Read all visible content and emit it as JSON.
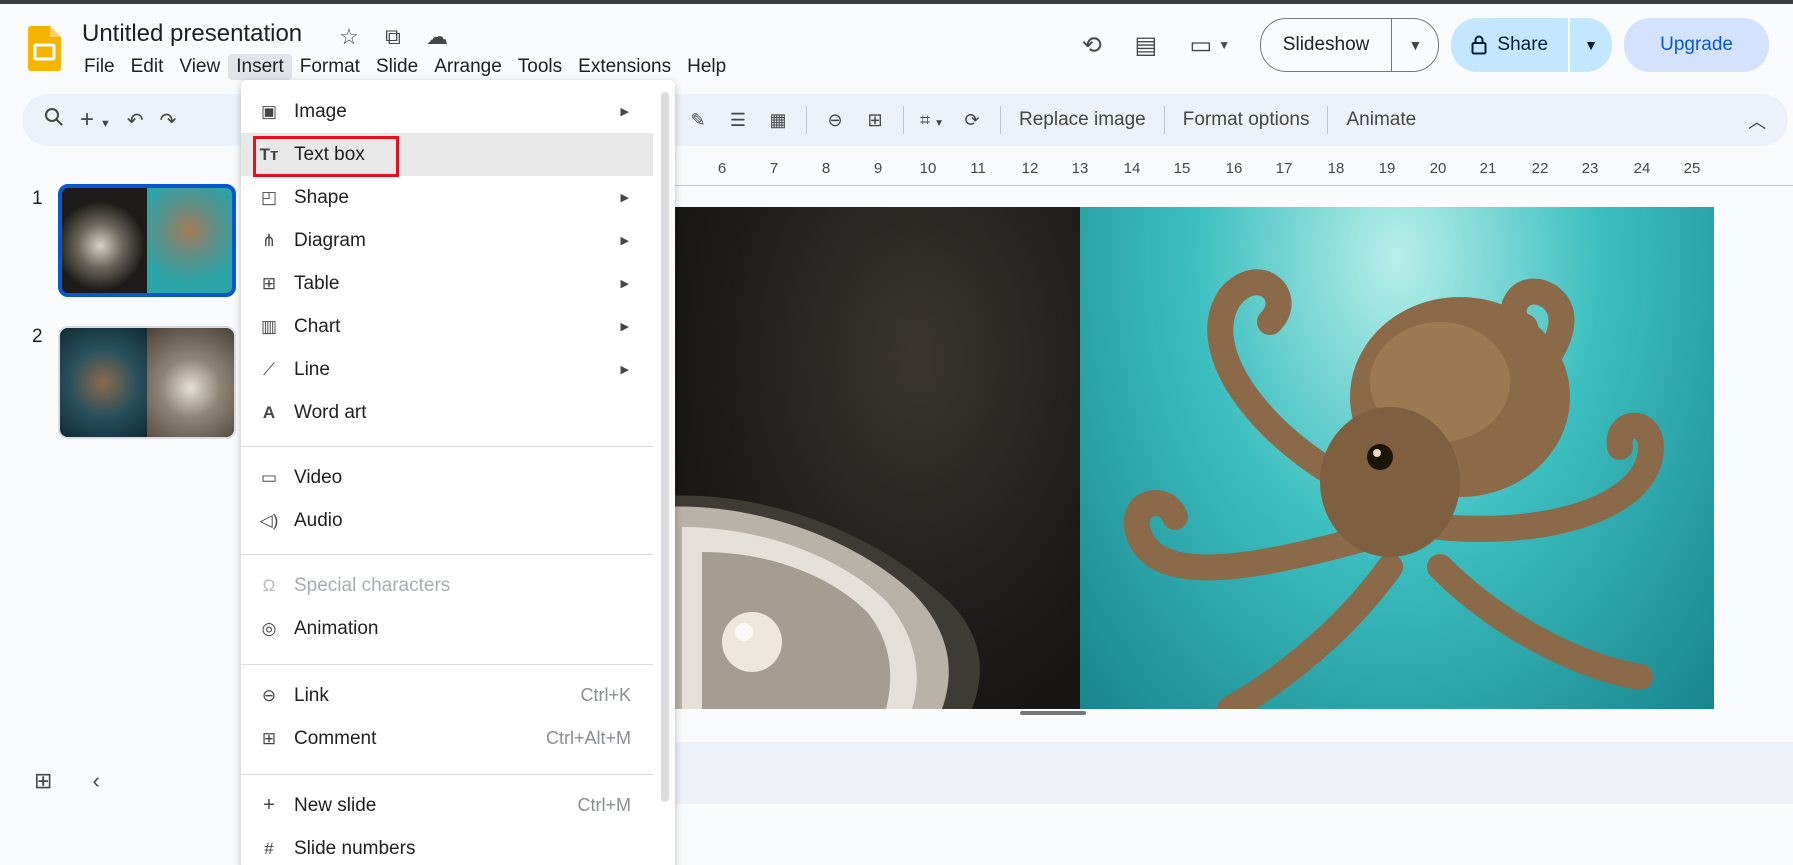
{
  "app": {
    "title": "Untitled presentation",
    "title_icons": [
      "star-icon",
      "move-to-folder-icon",
      "cloud-status-icon"
    ],
    "menu": [
      "File",
      "Edit",
      "View",
      "Insert",
      "Format",
      "Slide",
      "Arrange",
      "Tools",
      "Extensions",
      "Help"
    ],
    "active_menu": "Insert"
  },
  "header_actions": {
    "icons": [
      "history-icon",
      "comment-icon",
      "video-call-icon"
    ],
    "slideshow_label": "Slideshow",
    "share_label": "Share",
    "upgrade_label": "Upgrade"
  },
  "toolbar": {
    "left_icons": [
      "search-icon",
      "add-icon",
      "undo-icon",
      "redo-icon"
    ],
    "right_icons": [
      "pen-icon",
      "border-weight-icon",
      "border-dash-icon",
      "link-icon",
      "add-comment-icon",
      "crop-icon",
      "reset-image-icon"
    ],
    "replace_image": "Replace image",
    "format_options": "Format options",
    "animate": "Animate"
  },
  "slides": [
    {
      "number": "1",
      "selected": true
    },
    {
      "number": "2",
      "selected": false
    }
  ],
  "ruler": [
    "6",
    "7",
    "8",
    "9",
    "10",
    "11",
    "12",
    "13",
    "14",
    "15",
    "16",
    "17",
    "18",
    "19",
    "20",
    "21",
    "22",
    "23",
    "24",
    "25"
  ],
  "insert_menu": {
    "items": [
      {
        "label": "Image",
        "icon": "image-icon",
        "submenu": true
      },
      {
        "label": "Text box",
        "icon": "text-box-icon",
        "highlighted": true
      },
      {
        "label": "Shape",
        "icon": "shape-icon",
        "submenu": true
      },
      {
        "label": "Diagram",
        "icon": "diagram-icon",
        "submenu": true
      },
      {
        "label": "Table",
        "icon": "table-icon",
        "submenu": true
      },
      {
        "label": "Chart",
        "icon": "chart-icon",
        "submenu": true
      },
      {
        "label": "Line",
        "icon": "line-icon",
        "submenu": true
      },
      {
        "label": "Word art",
        "icon": "word-art-icon"
      },
      {
        "label": "Video",
        "icon": "video-icon"
      },
      {
        "label": "Audio",
        "icon": "audio-icon"
      },
      {
        "label": "Special characters",
        "icon": "omega-icon",
        "disabled": true
      },
      {
        "label": "Animation",
        "icon": "animation-icon"
      },
      {
        "label": "Link",
        "icon": "link-icon",
        "shortcut": "Ctrl+K"
      },
      {
        "label": "Comment",
        "icon": "comment-add-icon",
        "shortcut": "Ctrl+Alt+M"
      },
      {
        "label": "New slide",
        "icon": "plus-icon",
        "shortcut": "Ctrl+M"
      },
      {
        "label": "Slide numbers",
        "icon": "hash-icon"
      }
    ]
  },
  "colors": {
    "accent": "#0b57d0",
    "share_bg": "#c2e7ff",
    "highlight_box": "#e8101d"
  }
}
